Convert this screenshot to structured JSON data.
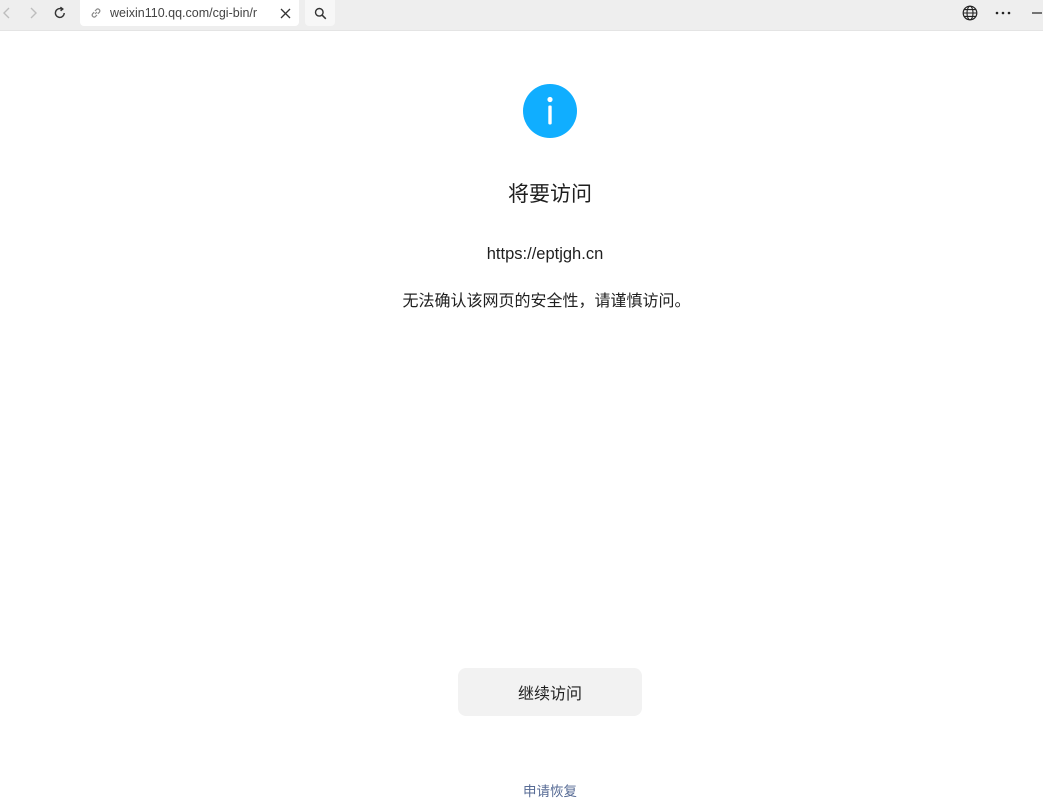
{
  "browser": {
    "address_text": "weixin110.qq.com/cgi-bin/r"
  },
  "page": {
    "title": "将要访问",
    "target_url": "https://eptjgh.cn",
    "warning": "无法确认该网页的安全性，请谨慎访问。",
    "continue_label": "继续访问",
    "restore_label": "申请恢复"
  },
  "colors": {
    "info_icon": "#10aeff",
    "restore_link": "#576b95",
    "button_bg": "#f2f2f2"
  },
  "icons": {
    "back": "back-arrow-icon",
    "forward": "forward-arrow-icon",
    "reload": "reload-icon",
    "link": "link-icon",
    "clear": "close-icon",
    "search": "search-icon",
    "globe": "globe-icon",
    "more": "more-icon",
    "minimize": "minimize-icon",
    "info": "info-icon"
  }
}
